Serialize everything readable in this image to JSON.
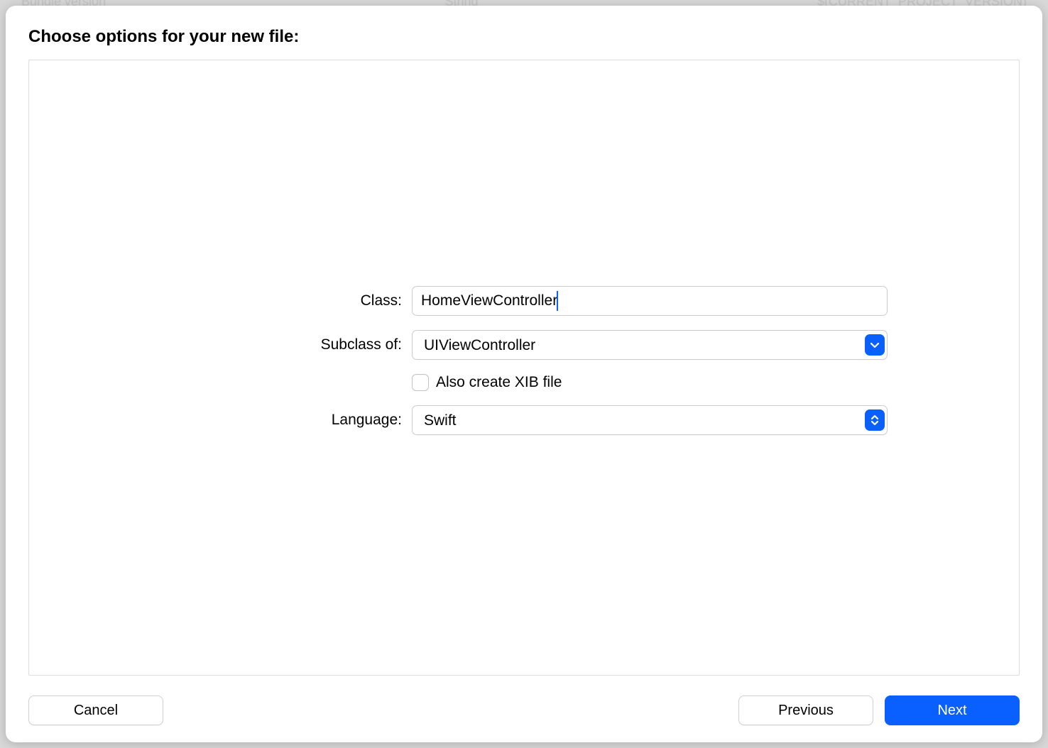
{
  "background": {
    "left": "Bundle version",
    "middle": "String",
    "right": "$(CURRENT_PROJECT_VERSION)"
  },
  "dialog": {
    "title": "Choose options for your new file:",
    "fields": {
      "class_label": "Class:",
      "class_value": "HomeViewController",
      "subclass_label": "Subclass of:",
      "subclass_value": "UIViewController",
      "xib_label": "Also create XIB file",
      "xib_checked": false,
      "language_label": "Language:",
      "language_value": "Swift"
    },
    "buttons": {
      "cancel": "Cancel",
      "previous": "Previous",
      "next": "Next"
    }
  }
}
